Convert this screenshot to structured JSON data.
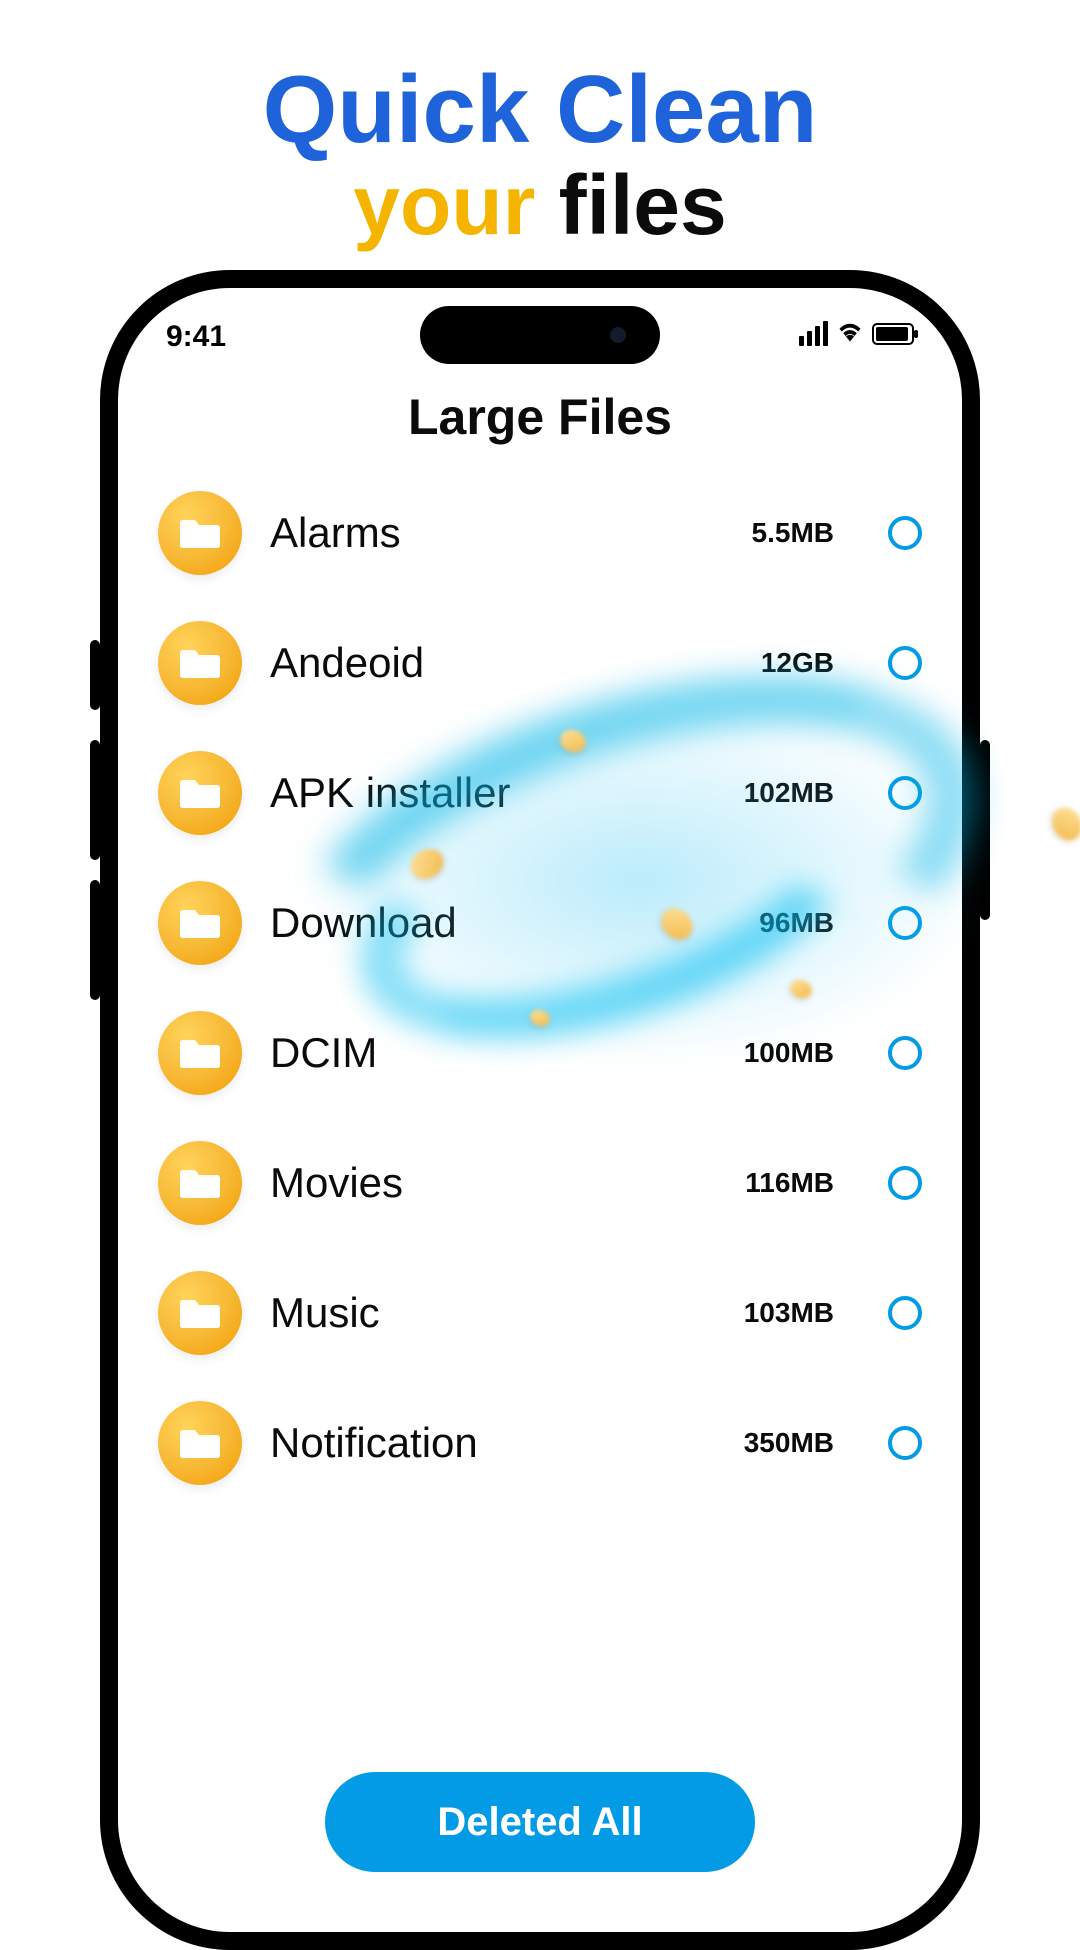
{
  "promo": {
    "line1": "Quick Clean",
    "your": "your",
    "files": "files"
  },
  "status": {
    "time": "9:41"
  },
  "app": {
    "title": "Large Files",
    "cta_label": "Deleted All",
    "folders": [
      {
        "name": "Alarms",
        "size": "5.5MB"
      },
      {
        "name": "Andeoid",
        "size": "12GB"
      },
      {
        "name": "APK installer",
        "size": "102MB"
      },
      {
        "name": "Download",
        "size": "96MB"
      },
      {
        "name": "DCIM",
        "size": "100MB"
      },
      {
        "name": "Movies",
        "size": "116MB"
      },
      {
        "name": "Music",
        "size": "103MB"
      },
      {
        "name": "Notification",
        "size": "350MB"
      }
    ]
  },
  "colors": {
    "brand_blue": "#1f63da",
    "accent_yellow": "#f5b400",
    "action_blue": "#039be5",
    "folder_orange": "#f7b733"
  }
}
